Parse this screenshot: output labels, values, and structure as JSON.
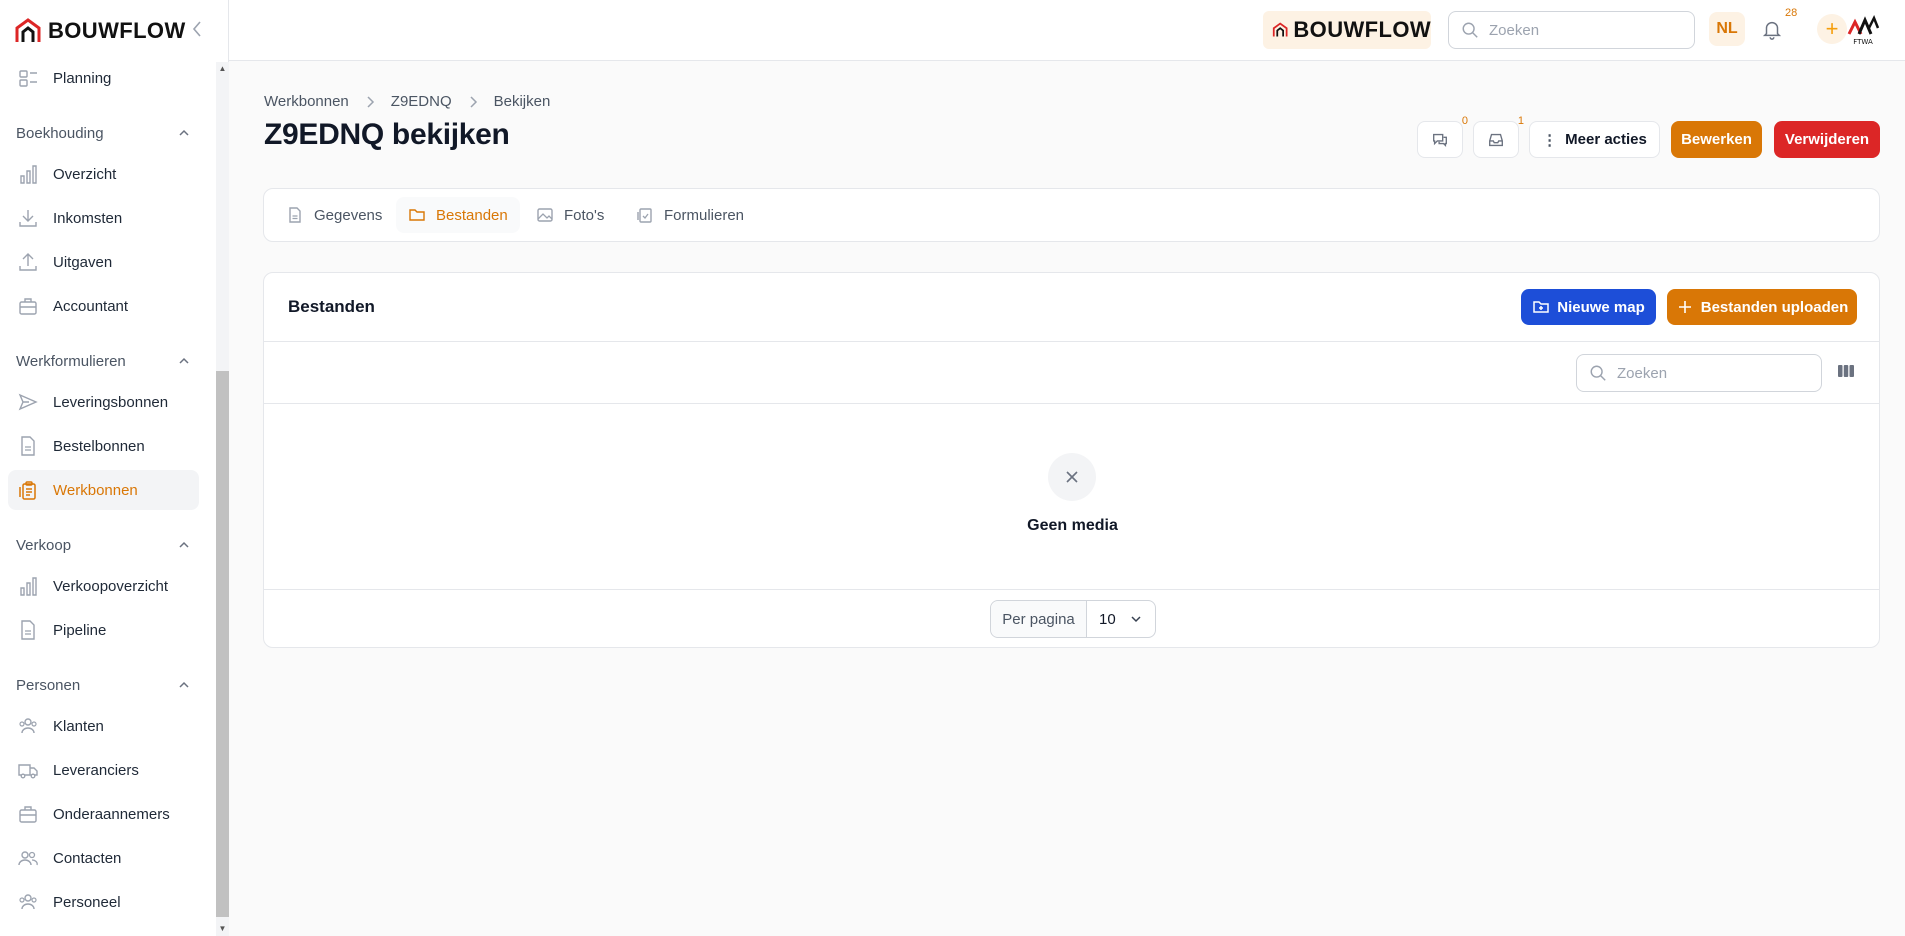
{
  "brand": {
    "name": "BOUWFLOW"
  },
  "sidebar": {
    "items": [
      {
        "type": "item",
        "label": "Planning",
        "icon": "planning-icon"
      },
      {
        "type": "group",
        "label": "Boekhouding"
      },
      {
        "type": "item",
        "label": "Overzicht",
        "icon": "bar-chart-icon"
      },
      {
        "type": "item",
        "label": "Inkomsten",
        "icon": "download-icon"
      },
      {
        "type": "item",
        "label": "Uitgaven",
        "icon": "upload-icon"
      },
      {
        "type": "item",
        "label": "Accountant",
        "icon": "briefcase-icon"
      },
      {
        "type": "group",
        "label": "Werkformulieren"
      },
      {
        "type": "item",
        "label": "Leveringsbonnen",
        "icon": "send-icon"
      },
      {
        "type": "item",
        "label": "Bestelbonnen",
        "icon": "document-icon"
      },
      {
        "type": "item",
        "label": "Werkbonnen",
        "icon": "clipboard-icon",
        "active": true
      },
      {
        "type": "group",
        "label": "Verkoop"
      },
      {
        "type": "item",
        "label": "Verkoopoverzicht",
        "icon": "bar-chart-icon"
      },
      {
        "type": "item",
        "label": "Pipeline",
        "icon": "document-icon"
      },
      {
        "type": "group",
        "label": "Personen"
      },
      {
        "type": "item",
        "label": "Klanten",
        "icon": "users-icon"
      },
      {
        "type": "item",
        "label": "Leveranciers",
        "icon": "truck-icon"
      },
      {
        "type": "item",
        "label": "Onderaannemers",
        "icon": "briefcase-icon"
      },
      {
        "type": "item",
        "label": "Contacten",
        "icon": "contacts-icon"
      },
      {
        "type": "item",
        "label": "Personeel",
        "icon": "users-icon"
      }
    ]
  },
  "topbar": {
    "search_placeholder": "Zoeken",
    "language": "NL",
    "notification_count": "28"
  },
  "breadcrumb": [
    "Werkbonnen",
    "Z9EDNQ",
    "Bekijken"
  ],
  "page_title": "Z9EDNQ bekijken",
  "actions": {
    "comments_count": "0",
    "inbox_count": "1",
    "more_label": "Meer acties",
    "edit_label": "Bewerken",
    "delete_label": "Verwijderen"
  },
  "tabs": [
    {
      "label": "Gegevens",
      "icon": "document-icon"
    },
    {
      "label": "Bestanden",
      "icon": "folder-icon",
      "active": true
    },
    {
      "label": "Foto's",
      "icon": "image-icon"
    },
    {
      "label": "Formulieren",
      "icon": "forms-icon"
    }
  ],
  "files": {
    "title": "Bestanden",
    "new_folder_label": "Nieuwe map",
    "upload_label": "Bestanden uploaden",
    "search_placeholder": "Zoeken",
    "empty_text": "Geen media",
    "per_page_label": "Per pagina",
    "per_page_value": "10"
  },
  "colors": {
    "accent": "#d97706",
    "danger": "#dc2626",
    "primary": "#1d4ed8"
  }
}
